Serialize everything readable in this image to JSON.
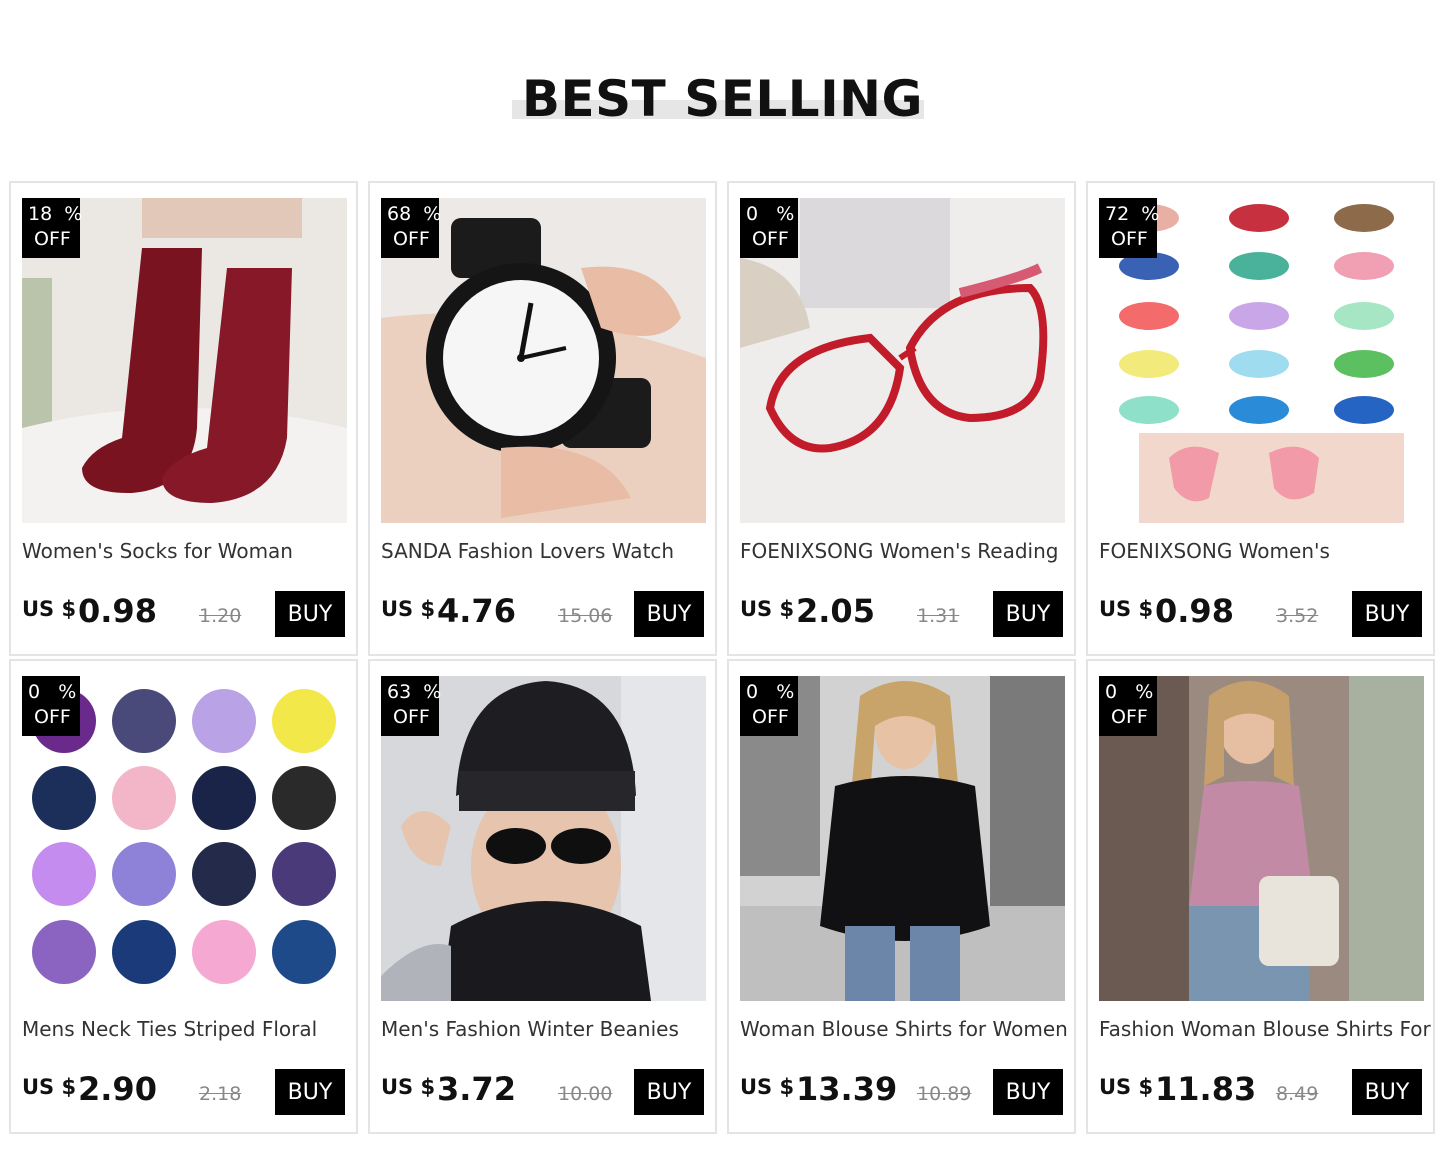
{
  "section": {
    "title": "BEST SELLING"
  },
  "products": [
    {
      "discount": "18  %",
      "off": "OFF",
      "name": "Women's Socks for Woman",
      "currency": "US $",
      "price": "0.98",
      "old_price": "1.20",
      "buy": "BUY",
      "image": "burgundy-socks-photo"
    },
    {
      "discount": "68  %",
      "off": "OFF",
      "name": "SANDA Fashion Lovers Watch",
      "currency": "US $",
      "price": "4.76",
      "old_price": "15.06",
      "buy": "BUY",
      "image": "black-wristwatch-photo"
    },
    {
      "discount": "0   %",
      "off": "OFF",
      "name": "FOENIXSONG Women's Reading",
      "currency": "US $",
      "price": "2.05",
      "old_price": "1.31",
      "buy": "BUY",
      "image": "red-reading-glasses-photo"
    },
    {
      "discount": "72  %",
      "off": "OFF",
      "name": "FOENIXSONG Women's",
      "currency": "US $",
      "price": "0.98",
      "old_price": "3.52",
      "buy": "BUY",
      "image": "heart-sunglasses-photo"
    },
    {
      "discount": "0   %",
      "off": "OFF",
      "name": "Mens Neck Ties Striped Floral",
      "currency": "US $",
      "price": "2.90",
      "old_price": "2.18",
      "buy": "BUY",
      "image": "neck-ties-grid-photo"
    },
    {
      "discount": "63  %",
      "off": "OFF",
      "name": "Men's Fashion Winter Beanies",
      "currency": "US $",
      "price": "3.72",
      "old_price": "10.00",
      "buy": "BUY",
      "image": "beanie-scarf-photo"
    },
    {
      "discount": "0   %",
      "off": "OFF",
      "name": "Woman Blouse Shirts for Women",
      "currency": "US $",
      "price": "13.39",
      "old_price": "10.89",
      "buy": "BUY",
      "image": "black-blouse-photo"
    },
    {
      "discount": "0   %",
      "off": "OFF",
      "name": "Fashion Woman Blouse Shirts For",
      "currency": "US $",
      "price": "11.83",
      "old_price": "8.49",
      "buy": "BUY",
      "image": "pink-tank-top-photo"
    }
  ],
  "colors": {
    "badge": "#000000",
    "buy_button": "#000000",
    "card_border": "#e4e4e4",
    "old_price": "#888888"
  }
}
